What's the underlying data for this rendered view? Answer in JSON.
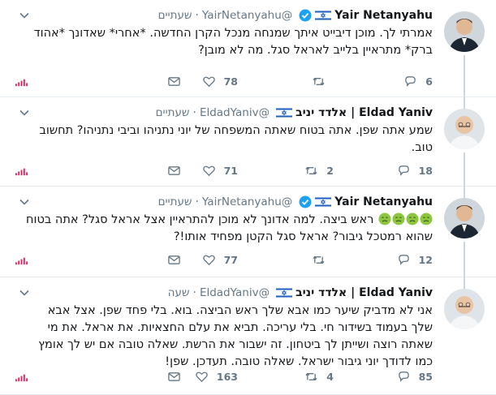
{
  "tweets": [
    {
      "name": "Yair Netanyahu",
      "handle": "@YairNetanyahu",
      "time": "שעתיים",
      "verified": true,
      "text": "אמרתי לך. מוכן דיבייט איתך שמנחה מנכל הקרן החדשה. *אחרי* שאדונך *אהוד ברק* מתראיין בלייב לאראל סגל. מה לא מובן?",
      "replies": "6",
      "retweets": "",
      "likes": "78"
    },
    {
      "name": "Eldad Yaniv | אלדד יניב",
      "handle": "@EldadYaniv",
      "time": "שעתיים",
      "verified": false,
      "text": "שמע אתה שפן. אתה בטוח שאתה המשפחה של יוני נתניהו וביבי נתניהו? תחשוב טוב.",
      "replies": "18",
      "retweets": "2",
      "likes": "71"
    },
    {
      "name": "Yair Netanyahu",
      "handle": "@YairNetanyahu",
      "time": "שעתיים",
      "verified": true,
      "text_before": "ראש ביצה. למה אדונך לא מוכן להתראיין אצל אראל סגל? אתה בטוח שהוא רמטכל גיבור? אראל סגל הקטן מפחיד אותו!?",
      "emoji_count": 4,
      "replies": "12",
      "retweets": "",
      "likes": "77"
    },
    {
      "name": "Eldad Yaniv | אלדד יניב",
      "handle": "@EldadYaniv",
      "time": "שעה",
      "verified": false,
      "text": "אני לא מדביק שיער כמו אבא שלך ראש הביצה. בוא. בלי פחד שפן. אצל אבא שלך בעמוד בשידור חי. בלי עריכה. תביא את עלם החצאיות. את אראל. את מי שאתה רוצה ושייתן לך ביטחון. זה ישבור את הרשת. שאלה טובה אם יש לך אומץ כמו לדודך יוני גיבור ישראל. שאלה טובה. תעדכן. שפן!",
      "replies": "85",
      "retweets": "4",
      "likes": "163"
    }
  ],
  "icons": {
    "reply": "reply-icon",
    "retweet": "retweet-icon",
    "like": "heart-icon",
    "dm": "envelope-icon",
    "stats": "analytics-icon",
    "caret": "chevron-down-icon",
    "flag": "israel-flag-icon",
    "verified": "verified-badge-icon",
    "emoji": "nauseated-face-emoji"
  },
  "colors": {
    "text": "#14171a",
    "muted": "#657786",
    "verified": "#1da1f2",
    "stats": "#e0245e",
    "thread_line": "#ccd6dd"
  }
}
